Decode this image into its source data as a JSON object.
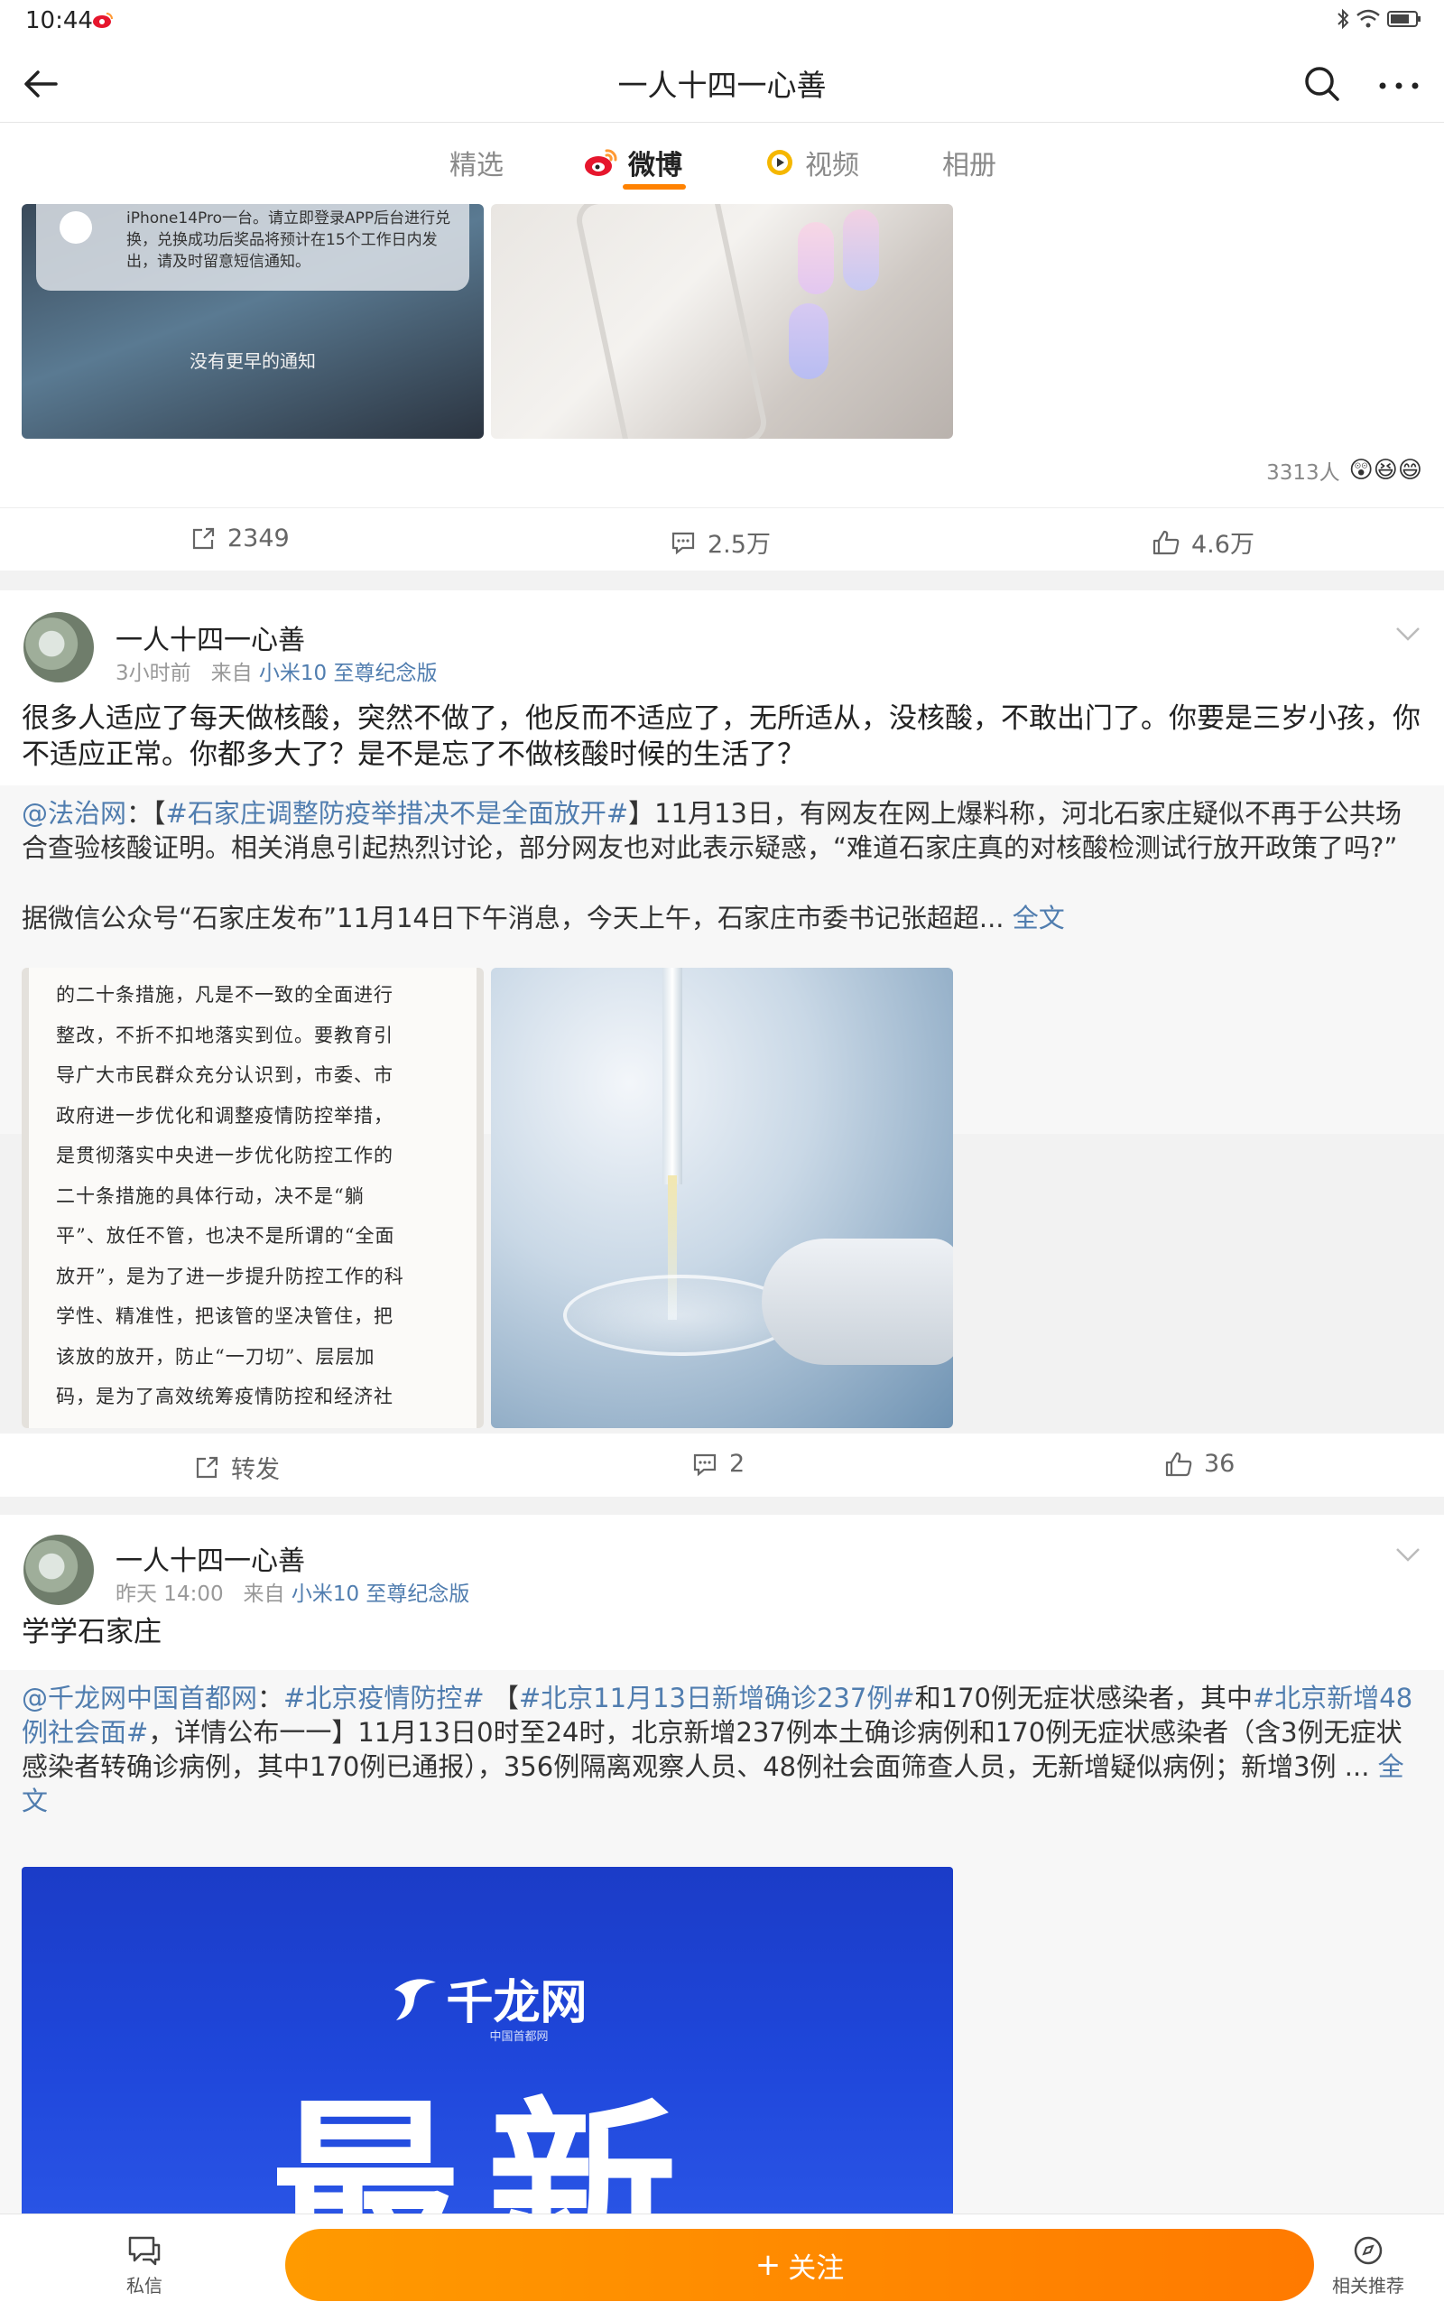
{
  "status_bar": {
    "time": "10:44"
  },
  "nav": {
    "title": "一人十四一心善"
  },
  "tabs": [
    {
      "label": "精选",
      "active": false
    },
    {
      "label": "微博",
      "active": true
    },
    {
      "label": "视频",
      "active": false
    },
    {
      "label": "相册",
      "active": false
    }
  ],
  "post0": {
    "image1_text": "iPhone14Pro一台。请立即登录APP后台进行兑换，兑换成功后奖品将预计在15个工作日内发出，请及时留意短信通知。",
    "image1_footer": "没有更早的通知",
    "reactions_count": "3313人",
    "repost_count": "2349",
    "comment_count": "2.5万",
    "like_count": "4.6万"
  },
  "post1": {
    "username": "一人十四一心善",
    "time": "3小时前",
    "from_label": "来自",
    "device": "小米10 至尊纪念版",
    "text": "很多人适应了每天做核酸，突然不做了，他反而不适应了，无所适从，没核酸，不敢出门了。你要是三岁小孩，你不适应正常。你都多大了？是不是忘了不做核酸时候的生活了？",
    "repost_author": "@法治网",
    "repost_sep": "：【",
    "repost_tag": "#石家庄调整防疫举措决不是全面放开#",
    "repost_body": "】11月13日，有网友在网上爆料称，河北石家庄疑似不再于公共场合查验核酸证明。相关消息引起热烈讨论，部分网友也对此表示疑惑，“难道石家庄真的对核酸检测试行放开政策了吗?”",
    "repost_body2": "据微信公众号“石家庄发布”11月14日下午消息，今天上午，石家庄市委书记张超超...",
    "full_text_label": "全文",
    "doc_lines": [
      "的二十条措施，凡是不一致的全面进行",
      "整改，不折不扣地落实到位。要教育引",
      "导广大市民群众充分认识到，市委、市",
      "政府进一步优化和调整疫情防控举措，",
      "是贯彻落实中央进一步优化防控工作的",
      "二十条措施的具体行动，决不是“躺",
      "平”、放任不管，也决不是所谓的“全面",
      "放开”，是为了进一步提升防控工作的科",
      "学性、精准性，把该管的坚决管住，把",
      "该放的放开，防止“一刀切”、层层加",
      "码，是为了高效统筹疫情防控和经济社"
    ],
    "repost_label": "转发",
    "comment_count": "2",
    "like_count": "36"
  },
  "post2": {
    "username": "一人十四一心善",
    "time": "昨天 14:00",
    "from_label": "来自",
    "device": "小米10 至尊纪念版",
    "text": "学学石家庄",
    "repost_author": "@千龙网中国首都网",
    "repost_sep1": "：",
    "repost_tag1": "#北京疫情防控#",
    "repost_mid1": " 【",
    "repost_tag2": "#北京11月13日新增确诊237例#",
    "repost_mid2": "和170例无症状感染者，其中",
    "repost_tag3": "#北京新增48例社会面#",
    "repost_body": "，详情公布一一】11月13日0时至24时，北京新增237例本土确诊病例和170例无症状感染者（含3例无症状感染者转确诊病例，其中170例已通报），356例隔离观察人员、48例社会面筛查人员，无新增疑似病例；新增3例 ...",
    "full_text_label": "全文",
    "image_logo": "千龙网",
    "image_logo_sub": "中国首都网",
    "image_big": "最新"
  },
  "bottom": {
    "message_label": "私信",
    "follow_label": "关注",
    "related_label": "相关推荐"
  },
  "colors": {
    "accent": "#ff8200",
    "link": "#507daf"
  }
}
